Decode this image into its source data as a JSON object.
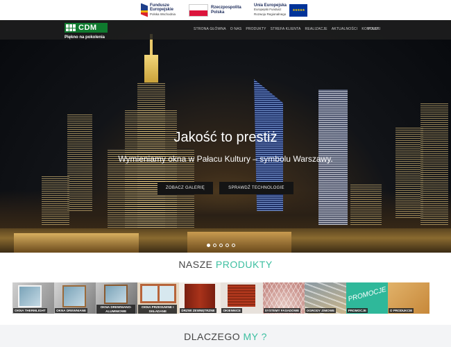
{
  "eu": {
    "fe_line1": "Fundusze",
    "fe_line2": "Europejskie",
    "fe_small": "Polska Wschodnia",
    "rp_line1": "Rzeczpospolita",
    "rp_line2": "Polska",
    "ue_line1": "Unia Europejska",
    "ue_small1": "Europejski Fundusz",
    "ue_small2": "Rozwoju Regionalnego"
  },
  "header": {
    "logo": "CDM",
    "tagline": "Piękno na pokolenia",
    "nav": [
      "STRONA GŁÓWNA",
      "O NAS",
      "PRODUKTY",
      "STREFA KLIENTA",
      "REALIZACJE",
      "AKTUALNOŚCI",
      "KONTAKT"
    ],
    "lang": "POLSKI"
  },
  "hero": {
    "title": "Jakość to prestiż",
    "subtitle": "Wymieniamy okna w Pałacu Kultury – symbolu Warszawy.",
    "btn_gallery": "ZOBACZ GALERIĘ",
    "btn_tech": "SPRAWDŹ TECHNOLOGIE",
    "slides": 5,
    "active_slide": 0
  },
  "products_section": {
    "title_plain": "NASZE",
    "title_accent": "PRODUKTY",
    "items": [
      {
        "label": "OKNA THERMLIGHT"
      },
      {
        "label": "OKNA DREWNIANE"
      },
      {
        "label": "OKNA DREWNIANO-ALUMINIOWE"
      },
      {
        "label": "OKNA PRZESUWNE I SKŁADANE"
      },
      {
        "label": "DRZWI ZEWNĘTRZNE"
      },
      {
        "label": "OKIENNICE"
      },
      {
        "label": "SYSTEMY FASADOWE"
      },
      {
        "label": "OGRODY ZIMOWE"
      },
      {
        "label": "PROMOCJE",
        "overlay": "PROMOCJE"
      },
      {
        "label": "O PRODUKCIE"
      }
    ]
  },
  "why_section": {
    "title_plain": "DLACZEGO",
    "title_accent": "MY ?"
  }
}
